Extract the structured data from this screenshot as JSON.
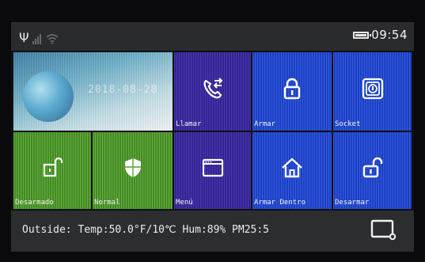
{
  "status": {
    "time": "09:54"
  },
  "hero": {
    "date": "2018-08-28"
  },
  "tiles": {
    "llamar": "Llamar",
    "armar": "Armar",
    "socket": "Socket",
    "desarmado": "Desarmado",
    "normal": "Normal",
    "menu": "Menú",
    "armar_dentro": "Armar Dentro",
    "desarmar": "Desarmar"
  },
  "bottom": {
    "weather": "Outside: Temp:50.0°F/10℃ Hum:89% PM25:5"
  },
  "icons": {
    "antenna": "antenna-icon",
    "signal": "signal-bars-icon",
    "wifi": "wifi-icon",
    "battery": "battery-icon",
    "llamar": "phone-transfer-icon",
    "armar": "padlock-closed-icon",
    "socket": "socket-icon",
    "desarmado": "door-unlocked-icon",
    "normal": "shield-icon",
    "menu": "window-icon",
    "armar_dentro": "house-icon",
    "desarmar": "padlock-open-icon",
    "screen": "screen-button-icon"
  },
  "colors": {
    "blue_tile": "#1f47d8",
    "purple_tile": "#3a2aa8",
    "green_tile": "#52a52b",
    "bar": "#2a2b2d"
  }
}
